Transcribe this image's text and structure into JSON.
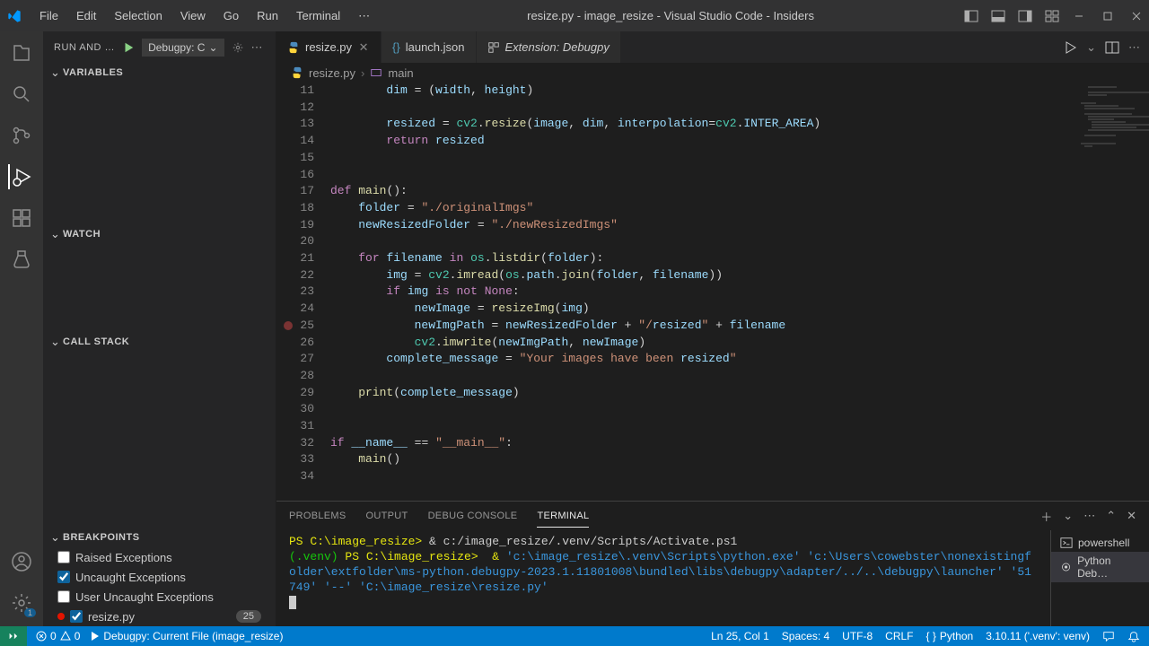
{
  "window": {
    "title": "resize.py - image_resize - Visual Studio Code - Insiders",
    "menu": [
      "File",
      "Edit",
      "Selection",
      "View",
      "Go",
      "Run",
      "Terminal"
    ]
  },
  "debug_panel": {
    "header": "RUN AND …",
    "config": "Debugpy: C",
    "sections": {
      "variables": "VARIABLES",
      "watch": "WATCH",
      "callstack": "CALL STACK",
      "breakpoints": "BREAKPOINTS"
    },
    "breakpoints": {
      "raised": "Raised Exceptions",
      "uncaught": "Uncaught Exceptions",
      "user_uncaught": "User Uncaught Exceptions",
      "file": "resize.py",
      "file_line": "25"
    }
  },
  "tabs": [
    {
      "label": "resize.py",
      "active": true,
      "kind": "python"
    },
    {
      "label": "launch.json",
      "active": false,
      "kind": "json"
    },
    {
      "label": "Extension: Debugpy",
      "active": false,
      "kind": "ext",
      "italic": true
    }
  ],
  "breadcrumbs": {
    "file": "resize.py",
    "symbol": "main"
  },
  "code": {
    "first_line": 11,
    "lines": [
      "        dim = (width, height)",
      "",
      "        resized = cv2.resize(image, dim, interpolation=cv2.INTER_AREA)",
      "        return resized",
      "",
      "",
      "def main():",
      "    folder = \"./originalImgs\"",
      "    newResizedFolder = \"./newResizedImgs\"",
      "",
      "    for filename in os.listdir(folder):",
      "        img = cv2.imread(os.path.join(folder, filename))",
      "        if img is not None:",
      "            newImage = resizeImg(img)",
      "            newImgPath = newResizedFolder + \"/resized\" + filename",
      "            cv2.imwrite(newImgPath, newImage)",
      "        complete_message = \"Your images have been resized\"",
      "",
      "    print(complete_message)",
      "",
      "",
      "if __name__ == \"__main__\":",
      "    main()",
      ""
    ],
    "breakpoint_line": 25
  },
  "panel": {
    "tabs": [
      "PROBLEMS",
      "OUTPUT",
      "DEBUG CONSOLE",
      "TERMINAL"
    ],
    "active_tab": "TERMINAL",
    "terminals": [
      "powershell",
      "Python Deb…"
    ],
    "lines": {
      "l1_prompt": "PS C:\\image_resize>",
      "l1_cmd": " & c:/image_resize/.venv/Scripts/Activate.ps1",
      "l2_venv": "(.venv)",
      "l2_prompt": " PS C:\\image_resize>  & ",
      "l2_path1": "'c:\\image_resize\\.venv\\Scripts\\python.exe' 'c:\\Users\\cowebster\\nonexistingfolder\\extfolder\\ms-python.debugpy-2023.1.11801008\\bundled\\libs\\debugpy\\adapter/../..\\debugpy\\launcher' '51749' '--' 'C:\\image_resize\\resize.py'"
    }
  },
  "status": {
    "errors": "0",
    "warnings": "0",
    "debug": "Debugpy: Current File (image_resize)",
    "cursor": "Ln 25, Col 1",
    "spaces": "Spaces: 4",
    "encoding": "UTF-8",
    "eol": "CRLF",
    "lang": "Python",
    "interpreter": "3.10.11 ('.venv': venv)"
  }
}
